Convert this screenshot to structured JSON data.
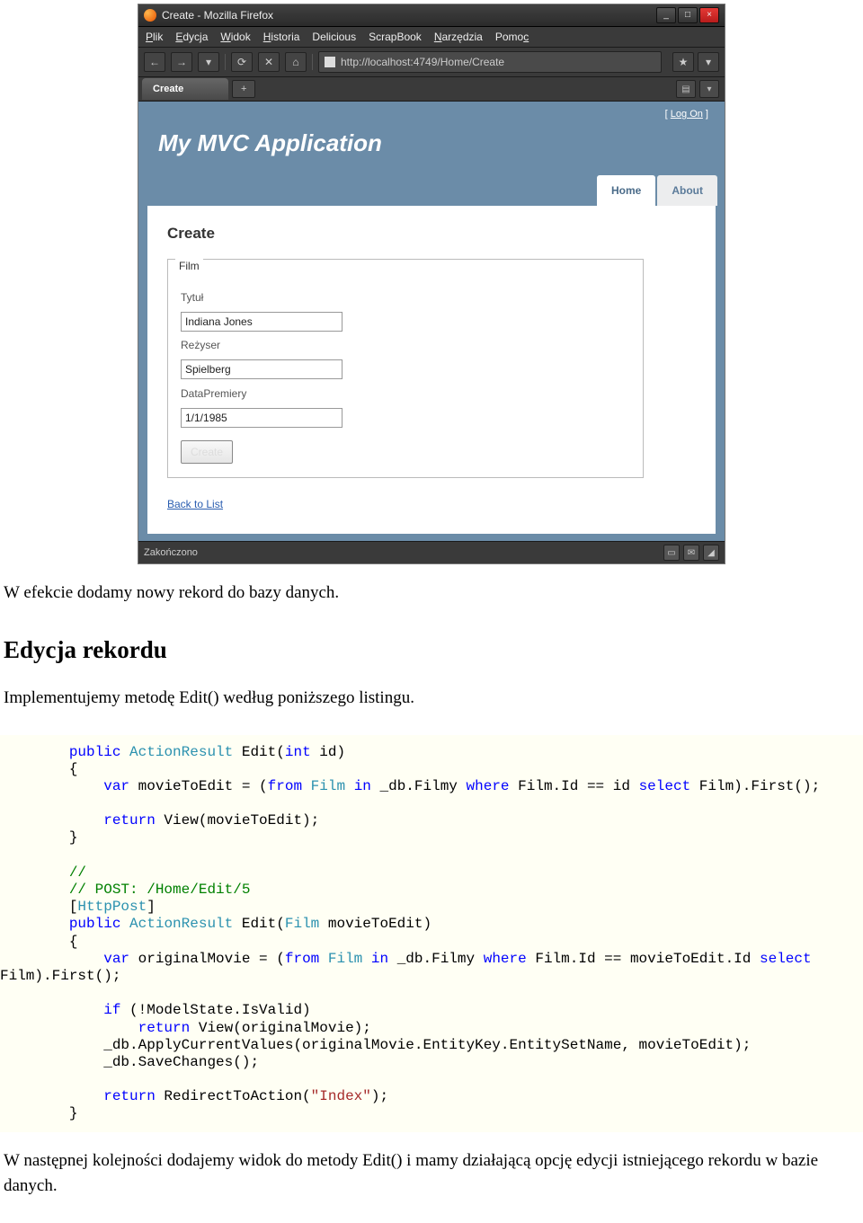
{
  "screenshot": {
    "window_title": "Create - Mozilla Firefox",
    "menu": {
      "plik": "Plik",
      "edycja": "Edycja",
      "widok": "Widok",
      "historia": "Historia",
      "delicious": "Delicious",
      "scrapbook": "ScrapBook",
      "narzedzia": "Narzędzia",
      "pomoc": "Pomoc"
    },
    "url": "http://localhost:4749/Home/Create",
    "tab_name": "Create",
    "logon": "Log On",
    "site_title": "My MVC Application",
    "nav": {
      "home": "Home",
      "about": "About"
    },
    "form": {
      "heading": "Create",
      "legend": "Film",
      "label_tytul": "Tytuł",
      "value_tytul": "Indiana Jones",
      "label_rezyser": "Reżyser",
      "value_rezyser": "Spielberg",
      "label_data": "DataPremiery",
      "value_data": "1/1/1985",
      "submit": "Create",
      "back": "Back to List"
    },
    "status": "Zakończono"
  },
  "doc": {
    "p1": "W efekcie dodamy nowy rekord do bazy danych.",
    "h2": "Edycja rekordu",
    "p2": "Implementujemy metodę Edit() według poniższego listingu.",
    "code": {
      "kw_public1": "public",
      "type_ar1": "ActionResult",
      "sig1": " Edit(",
      "kw_int": "int",
      "sig1b": " id)",
      "brace_o1": "{",
      "kw_var1": "var",
      "line2a": " movieToEdit = (",
      "kw_from1": "from",
      "sp": " ",
      "type_film1": "Film",
      "kw_in1": "in",
      "line2b": " _db.Filmy ",
      "kw_where1": "where",
      "line2c": " Film.Id == id ",
      "kw_select1": "select",
      "line2d": " Film).First();",
      "kw_return1": "return",
      "line3": " View(movieToEdit);",
      "brace_c1": "}",
      "cm1": "//",
      "cm2": "// POST: /Home/Edit/5",
      "br_a": "[",
      "type_hp": "HttpPost",
      "br_b": "]",
      "kw_public2": "public",
      "type_ar2": "ActionResult",
      "sig2a": " Edit(",
      "type_film2": "Film",
      "sig2b": " movieToEdit)",
      "brace_o2": "{",
      "kw_var2": "var",
      "line5a": " originalMovie = (",
      "kw_from2": "from",
      "type_film3": "Film",
      "kw_in2": "in",
      "line5b": " _db.Filmy ",
      "kw_where2": "where",
      "line5c": " Film.Id == movieToEdit.Id ",
      "kw_select2": "select",
      "line6": "Film).First();",
      "kw_if": "if",
      "line7": " (!ModelState.IsValid)",
      "kw_return2": "return",
      "line8": " View(originalMovie);",
      "line9": "_db.ApplyCurrentValues(originalMovie.EntityKey.EntitySetName, movieToEdit);",
      "line10": "_db.SaveChanges();",
      "kw_return3": "return",
      "line11": " RedirectToAction(",
      "str_index": "\"Index\"",
      "line11b": ");",
      "brace_c2": "}"
    },
    "p3": "W następnej kolejności dodajemy widok do metody Edit() i mamy działającą opcję edycji istniejącego rekordu w bazie danych."
  }
}
